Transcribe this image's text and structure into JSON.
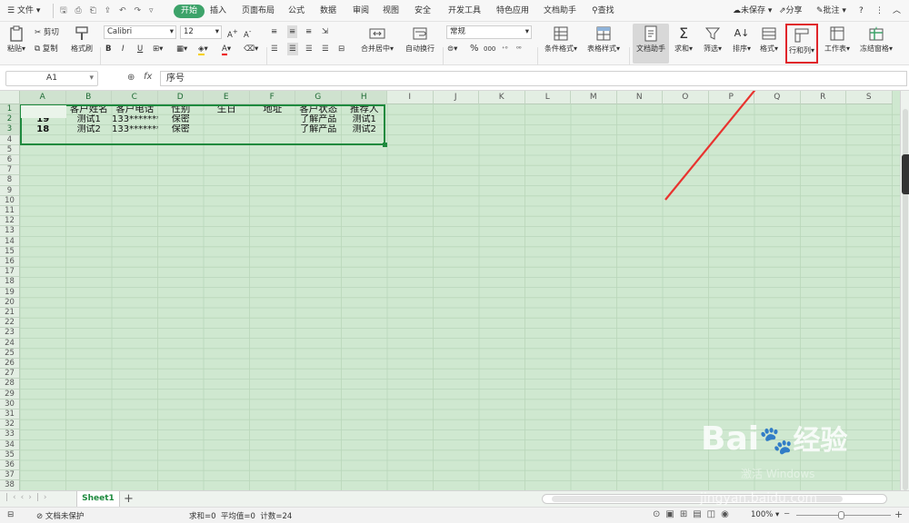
{
  "menubar": {
    "file_label": "文件",
    "tabs": [
      "开始",
      "插入",
      "页面布局",
      "公式",
      "数据",
      "审阅",
      "视图",
      "安全",
      "开发工具",
      "特色应用",
      "文档助手"
    ],
    "search_label": "查找",
    "unsaved_label": "未保存",
    "share_label": "分享",
    "comment_label": "批注"
  },
  "ribbon": {
    "paste": "粘贴",
    "cut": "剪切",
    "copy": "复制",
    "format_painter": "格式刷",
    "font_name": "Calibri",
    "font_size": "12",
    "merge_center": "合并居中",
    "wrap_text": "自动换行",
    "number_format": "常规",
    "percent_label": "%",
    "thousands_label": "000",
    "cond_format": "条件格式",
    "table_style": "表格样式",
    "doc_helper": "文档助手",
    "sum": "求和",
    "filter": "筛选",
    "sort": "排序",
    "format": "格式",
    "row_col": "行和列",
    "worksheet": "工作表",
    "freeze": "冻结窗格"
  },
  "formula_bar": {
    "cell_ref": "A1",
    "fx": "fx",
    "content": "序号"
  },
  "grid": {
    "columns": [
      "A",
      "B",
      "C",
      "D",
      "E",
      "F",
      "G",
      "H",
      "I",
      "J",
      "K",
      "L",
      "M",
      "N",
      "O",
      "P",
      "Q",
      "R",
      "S"
    ],
    "rows": [
      [
        "序号",
        "客户姓名",
        "客户电话",
        "性别",
        "生日",
        "地址",
        "客户状态",
        "推荐人"
      ],
      [
        "19",
        "测试1",
        "133*******",
        "保密",
        "",
        "",
        "了解产品",
        "测试1"
      ],
      [
        "18",
        "测试2",
        "133*******",
        "保密",
        "",
        "",
        "了解产品",
        "测试2"
      ]
    ]
  },
  "sheet_tabs": {
    "active": "Sheet1",
    "add": "+"
  },
  "status": {
    "protect": "文档未保护",
    "summary": "求和=0  平均值=0  计数=24",
    "zoom": "100%"
  },
  "watermark": {
    "activate": "激活 Windows",
    "site": "jingyan.baidu.com",
    "brand": "Bai",
    "brand2": "经验"
  },
  "colors": {
    "accent": "#3da36a",
    "grid_bg": "#cfe8d0",
    "highlight_box": "#e0242a",
    "arrow": "#e8332f",
    "selection": "#1e8a3e"
  }
}
